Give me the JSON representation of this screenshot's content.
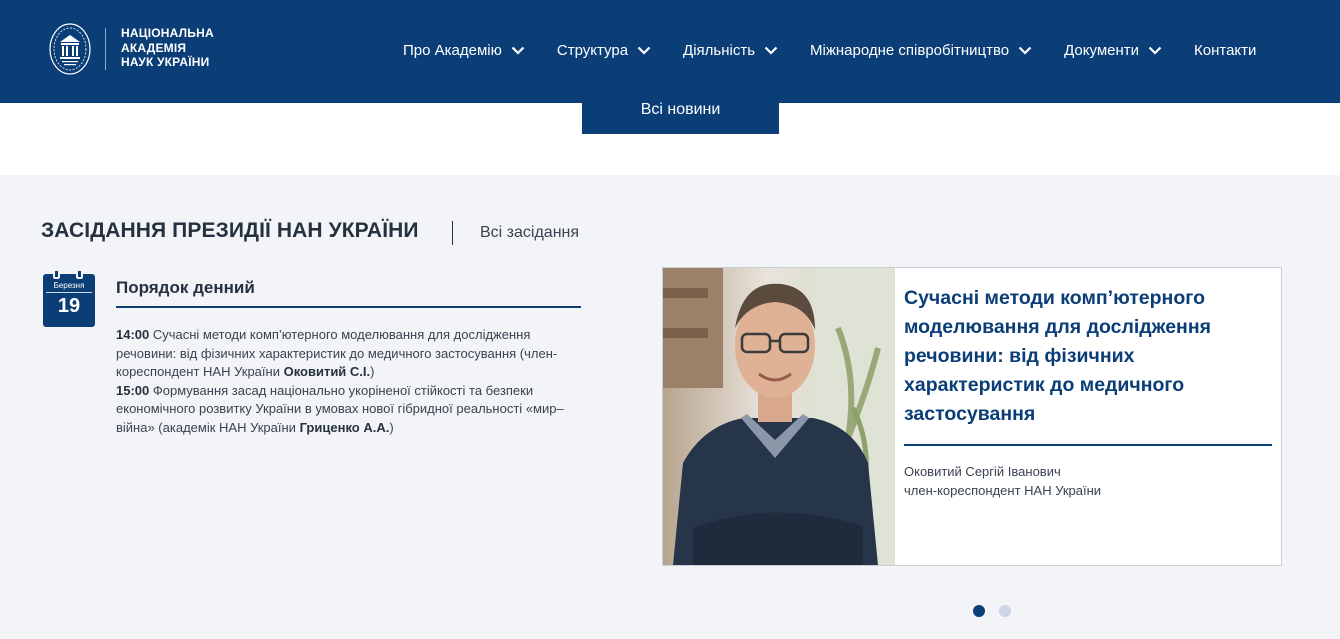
{
  "header": {
    "logo_lines": [
      "НАЦІОНАЛЬНА",
      "АКАДЕМІЯ",
      "НАУК УКРАЇНИ"
    ],
    "nav": [
      {
        "label": "Про Академію",
        "icon": "chevron-down-icon"
      },
      {
        "label": "Структура",
        "icon": "chevron-down-icon"
      },
      {
        "label": "Діяльність",
        "icon": "chevron-down-icon"
      },
      {
        "label": "Міжнародне співробітництво",
        "icon": "chevron-down-icon"
      },
      {
        "label": "Документи",
        "icon": "chevron-down-icon"
      },
      {
        "label": "Контакти"
      }
    ]
  },
  "news": {
    "all_news_label": "Всі новини"
  },
  "presidium": {
    "title": "ЗАСІДАННЯ ПРЕЗИДІЇ НАН УКРАЇНИ",
    "all_link": "Всі засідання",
    "calendar": {
      "month": "Березня",
      "day": "19"
    },
    "agenda_title": "Порядок денний",
    "agenda": [
      {
        "time": "14:00",
        "text": " Сучасні методи комп’ютерного моделювання для дослідження речовини: від фізичних характеристик до медичного застосування (член-кореспондент НАН України ",
        "speaker": "Оковитий С.І.",
        "suffix": ")"
      },
      {
        "time": "15:00",
        "text": " Формування засад національно укоріненої стійкості та безпеки економічного розвитку України в умовах нової гібридної реальності «мир–війна» (академік НАН України ",
        "speaker": "Гриценко А.А.",
        "suffix": ")"
      }
    ],
    "feature": {
      "title": "Сучасні методи комп’ютерного моделювання для дослідження речовини: від фізичних характеристик до медичного застосування",
      "person_name": "Оковитий Сергій Іванович",
      "person_title": "член-кореспондент НАН України"
    },
    "slider": {
      "count": 2,
      "active": 1
    }
  },
  "colors": {
    "brand": "#0b3e77",
    "section_bg": "#f2f4f8",
    "dot_inactive": "#cfd3e6"
  }
}
